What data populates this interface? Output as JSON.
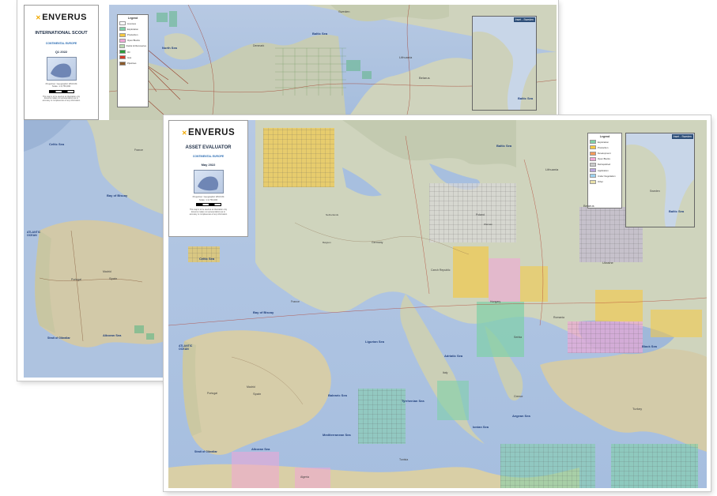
{
  "brand": {
    "logo_mark": "✕",
    "logo_text": "ENVERUS"
  },
  "back_map": {
    "title": "INTERNATIONAL SCOUT",
    "subtitle": "CONTINENTAL EUROPE",
    "date": "Q1 2022",
    "projection_lines": [
      "Projection: Geographic WGS 84",
      "Scale: 1:2,750,000"
    ],
    "footer_lines": [
      "This map is to be used as an illustration only",
      "Enverus makes no representations as to",
      "accuracy or completeness of any information"
    ],
    "legend": {
      "title": "Legend",
      "items": [
        {
          "label": "Licenses",
          "color": "#ffffff"
        },
        {
          "label": "Exploration",
          "color": "#7fd0a8"
        },
        {
          "label": "Production",
          "color": "#f5c842"
        },
        {
          "label": "Open Blocks",
          "color": "#f0a6d6"
        },
        {
          "label": "Fields & Discoveries",
          "color": "#b7d9b0"
        },
        {
          "label": "Oil",
          "color": "#2c9b3d"
        },
        {
          "label": "Gas",
          "color": "#d23a2a"
        },
        {
          "label": "Pipelines",
          "color": "#8a5a2b"
        }
      ]
    },
    "inset_title": "Inset - Sweden",
    "labels": {
      "north_sea": "North Sea",
      "baltic_sea": "Baltic Sea",
      "baltic_sea_2": "Baltic Sea",
      "celtic_sea": "Celtic Sea",
      "bay_of_biscay": "Bay of Biscay",
      "atlantic_ocean": "ATLANTIC OCEAN",
      "alboran_sea": "Alboran Sea",
      "strait_gibraltar": "Strait of Gibraltar",
      "sweden": "Sweden",
      "denmark": "Denmark",
      "lithuania": "Lithuania",
      "belarus": "Belarus",
      "spain": "Spain",
      "portugal": "Portugal",
      "madrid": "Madrid",
      "france": "France"
    }
  },
  "front_map": {
    "title": "ASSET EVALUATOR",
    "subtitle": "CONTINENTAL EUROPE",
    "date": "May 2022",
    "projection_lines": [
      "Projection: Geographic WGS 84",
      "Scale: 1:2,750,000"
    ],
    "footer_lines": [
      "This map is to be used as an illustration only",
      "Enverus makes no representations as to",
      "accuracy or completeness of any information"
    ],
    "legend": {
      "title": "Legend",
      "items": [
        {
          "label": "Exploration",
          "color": "#7fd0a8"
        },
        {
          "label": "Production",
          "color": "#f5c842"
        },
        {
          "label": "Development",
          "color": "#f29a5c"
        },
        {
          "label": "Open Blocks",
          "color": "#f0a6d6"
        },
        {
          "label": "Relinquished",
          "color": "#c9c9c9"
        },
        {
          "label": "Application",
          "color": "#b8a6e0"
        },
        {
          "label": "Under Negotiation",
          "color": "#9ed2f0"
        },
        {
          "label": "Other",
          "color": "#e8e0a8"
        }
      ]
    },
    "inset_title": "Inset - Sweden",
    "labels": {
      "baltic_sea": "Baltic Sea",
      "baltic_sea_inset": "Baltic Sea",
      "celtic_sea": "Celtic Sea",
      "bay_of_biscay": "Bay of Biscay",
      "atlantic_ocean": "ATLANTIC OCEAN",
      "ligurian_sea": "Ligurian Sea",
      "balearic_sea": "Balearic Sea",
      "mediterranean_sea": "Mediterranean Sea",
      "tyrrhenian_sea": "Tyrrhenian Sea",
      "adriatic_sea": "Adriatic Sea",
      "ionian_sea": "Ionian Sea",
      "aegean_sea": "Aegean Sea",
      "black_sea": "Black Sea",
      "alboran_sea": "Alboran Sea",
      "strait_gibraltar": "Strait of Gibraltar",
      "france": "France",
      "spain": "Spain",
      "portugal": "Portugal",
      "germany": "Germany",
      "poland": "Poland",
      "belarus": "Belarus",
      "ukraine": "Ukraine",
      "romania": "Romania",
      "serbia": "Serbia",
      "turkey": "Turkey",
      "lithuania": "Lithuania",
      "sweden": "Sweden",
      "algeria": "Algeria",
      "tunisia": "Tunisia",
      "czech_republic": "Czech Republic",
      "hungary": "Hungary",
      "italy": "Italy",
      "greece": "Greece",
      "madrid": "Madrid",
      "warsaw": "Warsaw",
      "belgium": "Belgium",
      "netherlands": "Netherlands"
    }
  }
}
